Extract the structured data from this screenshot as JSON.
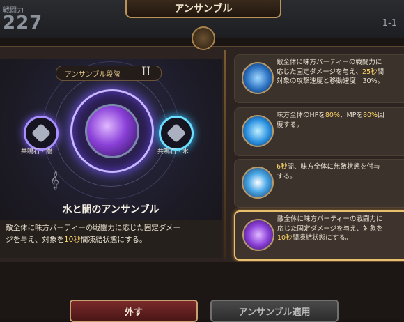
{
  "header": {
    "title": "アンサンブル",
    "power_label": "戦闘力",
    "power_value": "227",
    "stage": "1-1"
  },
  "ensemble": {
    "rank_label": "アンサンブル段階",
    "rank_value": "II",
    "left_stone": "共鳴石・闇",
    "right_stone": "共鳴石・水",
    "name": "水と闇のアンサンブル",
    "desc_1": "敵全体に味方パーティーの戦闘力に応じた固定ダメー",
    "desc_2a": "ジを与え、対象を",
    "desc_2b": "10秒",
    "desc_2c": "間凍結状態にする。"
  },
  "cards": [
    {
      "line1": "敵全体に味方パーティーの戦闘力に",
      "line2a": "応じた固定ダメージを与え、",
      "line2b": "25秒",
      "line2c": "間",
      "line3": "対象の攻撃速度と移動速度　30%。"
    },
    {
      "line1a": "味方全体のHPを",
      "line1b": "80%",
      "line1c": "、MPを",
      "line1d": "80%",
      "line1e": "回",
      "line2": "復する。"
    },
    {
      "line1a": "6秒",
      "line1b": "間、味方全体に無敵状態を付与",
      "line2": "する。"
    },
    {
      "line1": "敵全体に味方パーティーの戦闘力に",
      "line2": "応じた固定ダメージを与え、対象を",
      "line3a": "10秒",
      "line3b": "間凍結状態にする。"
    }
  ],
  "buttons": {
    "remove": "外す",
    "apply": "アンサンブル適用"
  },
  "colors": {
    "highlight": "#ffd86a",
    "accent_gold": "#e8c070",
    "remove_bg": "#6a2222",
    "apply_bg": "#3a3a3a"
  }
}
